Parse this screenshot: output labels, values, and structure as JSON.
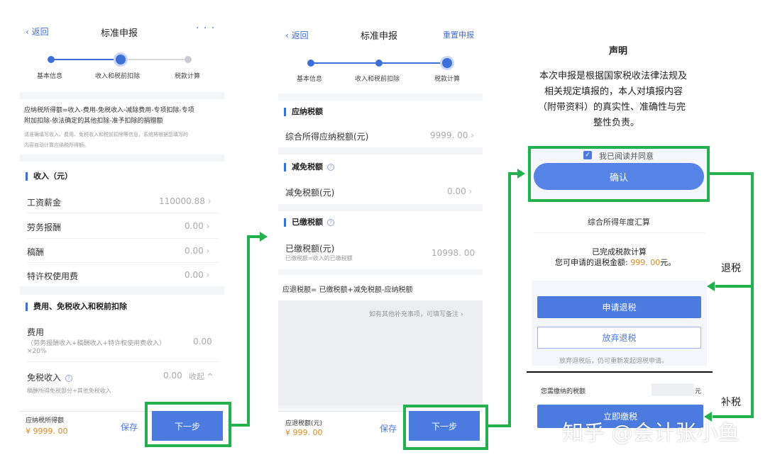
{
  "screen1": {
    "back": "返回",
    "title": "标准申报",
    "more": "· · ·",
    "steps": [
      "基本信息",
      "收入和税前扣除",
      "税款计算"
    ],
    "formula": "应纳税所得额=收入-费用-免税收入-减除费用-专项扣除-专项",
    "formula2": "附加扣除-依法确定的其他扣除-准予扣除的捐赠额",
    "hint1": "请准确填写收入、费用、免税收入和税前扣除等信息，系统将根据您填写的",
    "hint2": "内容自动计算应纳税所得额。",
    "income_head": "收入（元）",
    "income_rows": [
      {
        "label": "工资薪金",
        "value": "110000.88"
      },
      {
        "label": "劳务报酬",
        "value": "0.00"
      },
      {
        "label": "稿酬",
        "value": "0.00"
      },
      {
        "label": "特许权使用费",
        "value": "0.00"
      }
    ],
    "expense_head": "费用、免税收入和税前扣除",
    "fee_label": "费用",
    "fee_sub1": "（劳务报酬收入+稿酬收入+特许权使用费收入）",
    "fee_sub2": "×20%",
    "fee_value": "0.00",
    "exempt_label": "免税收入",
    "exempt_value": "0.00",
    "exempt_toggle": "收起",
    "exempt_sub": "稿酬所得免税部分+其他免税收入",
    "bottom_label": "应纳税所得额",
    "bottom_value": "¥ 9999. 00",
    "save": "保存",
    "next": "下一步"
  },
  "screen2": {
    "back": "返回",
    "title": "标准申报",
    "reset": "重置申报",
    "steps": [
      "基本信息",
      "收入和税前扣除",
      "税款计算"
    ],
    "payable_head": "应纳税额",
    "payable_label": "综合所得应纳税额(元)",
    "payable_value": "9999. 00",
    "relief_head": "减免税额",
    "relief_label": "减免税额(元)",
    "relief_value": "0.00",
    "paid_head": "已缴税额",
    "paid_label": "已缴税额(元)",
    "paid_sub": "已缴税额=收入的已缴税额",
    "paid_value": "10998. 00",
    "refund_formula": "应退税额= 已缴税额+减免税额-应纳税额",
    "remark": "如有其他补充事项，可填写备注",
    "bottom_label": "应退税额(元)",
    "bottom_value": "¥ 999. 00",
    "save": "保存",
    "next": "下一步"
  },
  "screen3": {
    "decl_title": "声明",
    "decl_lines": [
      "本次申报是根据国家税收法律法规及",
      "相关规定填报的，本人对填报内容",
      "（附带资料）的真实性、准确性与完",
      "整性负责。"
    ],
    "agree": "我已阅读并同意",
    "confirm": "确认",
    "annual_title": "综合所得年度汇算",
    "done_text": "已完成税款计算",
    "refund_prefix": "您可申请的退税金额:",
    "refund_amount": "999. 00",
    "refund_suffix": "元。",
    "apply_refund": "申请退税",
    "give_up": "放弃退税",
    "give_up_note": "放弃退税后，仍可重新发起退税申请。",
    "pay_label": "您需缴纳的税额",
    "pay_unit": "元",
    "pay_now": "立即缴税",
    "label_refund": "退税",
    "label_supplement": "补税",
    "watermark": "知乎 @会计张小鱼"
  },
  "colors": {
    "accent": "#4c7be0",
    "annotation": "#22b14c",
    "amount": "#d98a1c"
  }
}
